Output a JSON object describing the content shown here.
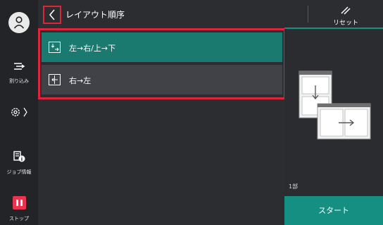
{
  "header": {
    "title": "レイアウト順序",
    "reset_label": "リセット"
  },
  "sidebar": {
    "interrupt_label": "割り込み",
    "job_status_label": "ジョブ情報",
    "stop_label": "ストップ"
  },
  "options": [
    {
      "label": "左→右/上→下",
      "selected": true
    },
    {
      "label": "右→左",
      "selected": false
    }
  ],
  "right_panel": {
    "copies": "1部",
    "start_label": "スタート"
  },
  "colors": {
    "accent_teal": "#168f83",
    "selected_option": "#1b7a70",
    "highlight_red": "#e0243c",
    "stop_red": "#e8344e"
  }
}
